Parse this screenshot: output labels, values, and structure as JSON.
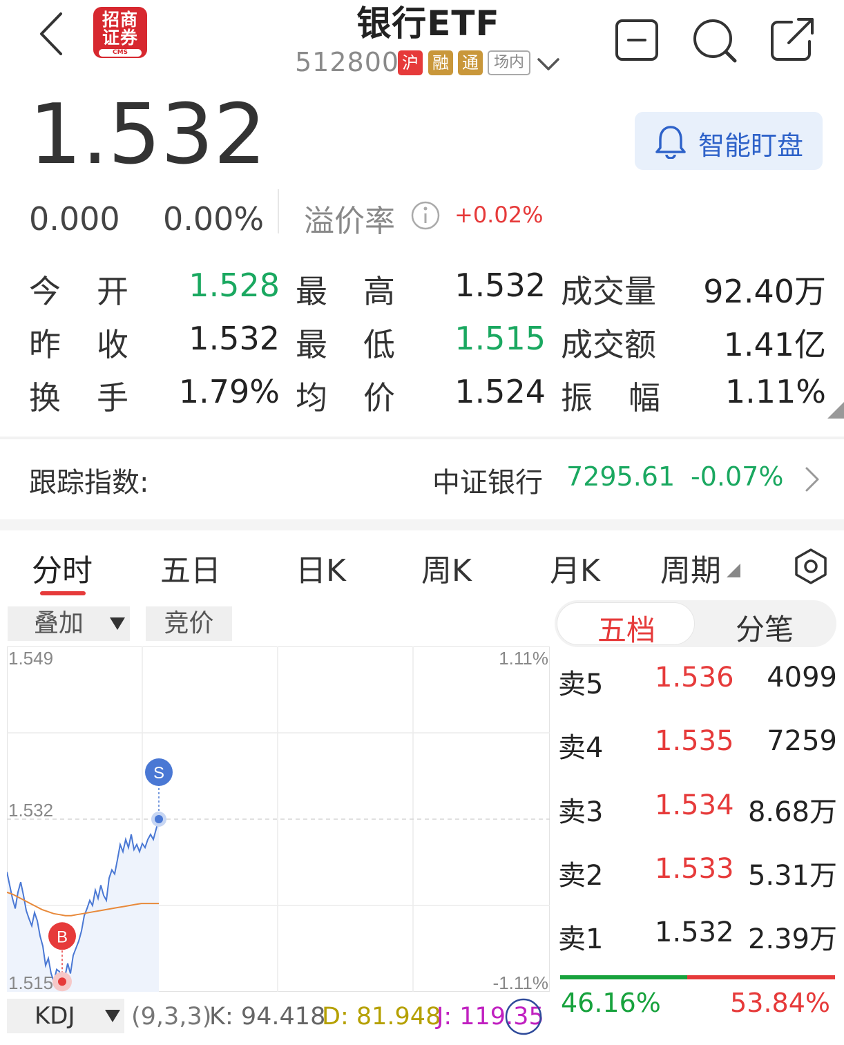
{
  "header": {
    "back_icon": "chevron-left-icon",
    "logo": {
      "line1": "招商",
      "line2": "证券",
      "line3": "CMS"
    },
    "title": "银行ETF",
    "code": "512800",
    "tags": [
      "沪",
      "融",
      "通",
      "场内"
    ],
    "actions": [
      "minus-square-icon",
      "search-icon",
      "share-icon"
    ]
  },
  "quote": {
    "price": "1.532",
    "change": "0.000",
    "change_pct": "0.00%",
    "premium_label": "溢价率",
    "premium_value": "+0.02%",
    "smart_watch": "智能盯盘"
  },
  "stats": [
    {
      "label1": "今",
      "label2": "开",
      "value": "1.528"
    },
    {
      "label1": "最",
      "label2": "高",
      "value": "1.532"
    },
    {
      "label": "成交量",
      "value": "92.40万"
    },
    {
      "label1": "昨",
      "label2": "收",
      "value": "1.532"
    },
    {
      "label1": "最",
      "label2": "低",
      "value": "1.515"
    },
    {
      "label": "成交额",
      "value": "1.41亿"
    },
    {
      "label1": "换",
      "label2": "手",
      "value": "1.79%"
    },
    {
      "label1": "均",
      "label2": "价",
      "value": "1.524"
    },
    {
      "label1": "振",
      "label2": "幅",
      "value": "1.11%"
    }
  ],
  "tracking": {
    "label": "跟踪指数:",
    "index_name": "中证银行",
    "index_value": "7295.61",
    "index_change": "-0.07%"
  },
  "tabs": [
    "分时",
    "五日",
    "日K",
    "周K",
    "月K",
    "周期"
  ],
  "chart_controls": {
    "overlay": "叠加",
    "auction": "竞价"
  },
  "chart_data": {
    "type": "line",
    "y_labels_left": [
      "1.549",
      "1.532",
      "1.515"
    ],
    "y_labels_right": [
      "1.11%",
      "-1.11%"
    ],
    "ylim": [
      1.515,
      1.549
    ],
    "series": [
      {
        "values": [
          1.5268,
          1.5255,
          1.5242,
          1.5232,
          1.5248,
          1.5258,
          1.5245,
          1.523,
          1.5222,
          1.5215,
          1.5228,
          1.522,
          1.5205,
          1.5195,
          1.5176,
          1.5183,
          1.5168,
          1.516,
          1.5172,
          1.517,
          1.5153,
          1.5165,
          1.5178,
          1.5168,
          1.5186,
          1.5193,
          1.52,
          1.521,
          1.5225,
          1.5232,
          1.524,
          1.5235,
          1.525,
          1.5242,
          1.5255,
          1.5245,
          1.524,
          1.5262,
          1.527,
          1.5266,
          1.528,
          1.5295,
          1.5288,
          1.53,
          1.5292,
          1.5305,
          1.529,
          1.5295,
          1.5288,
          1.5296,
          1.5292,
          1.53,
          1.5305,
          1.53,
          1.531,
          1.532
        ]
      },
      {
        "values": [
          1.5248,
          1.5246,
          1.5243,
          1.524,
          1.5237,
          1.5234,
          1.5231,
          1.5229,
          1.5227,
          1.5226,
          1.5225,
          1.5225,
          1.5226,
          1.5227,
          1.5228,
          1.5229,
          1.523,
          1.5231,
          1.5232,
          1.5233,
          1.5234,
          1.5235,
          1.5236,
          1.5237,
          1.5237,
          1.5237,
          1.5237
        ]
      }
    ],
    "markers": [
      {
        "label": "B",
        "value": 1.516
      },
      {
        "label": "S",
        "value": 1.532
      }
    ]
  },
  "orderbook": {
    "tabs": [
      "五档",
      "分笔"
    ],
    "rows": [
      {
        "label": "卖5",
        "price": "1.536",
        "vol": "4099"
      },
      {
        "label": "卖4",
        "price": "1.535",
        "vol": "7259"
      },
      {
        "label": "卖3",
        "price": "1.534",
        "vol": "8.68万"
      },
      {
        "label": "卖2",
        "price": "1.533",
        "vol": "5.31万"
      },
      {
        "label": "卖1",
        "price": "1.532",
        "vol": "2.39万"
      }
    ],
    "buy_pct": "46.16%",
    "sell_pct": "53.84%",
    "buy_ratio": 0.4616
  },
  "kdj": {
    "name": "KDJ",
    "params": "(9,3,3)",
    "k": "K: 94.418",
    "d": "D: 81.948",
    "j": "J: 119.35"
  },
  "colors": {
    "red": "#e63a3a",
    "green": "#1aa860",
    "blue": "#2e62c9",
    "line": "#4a78d4",
    "avg": "#e8893a"
  }
}
